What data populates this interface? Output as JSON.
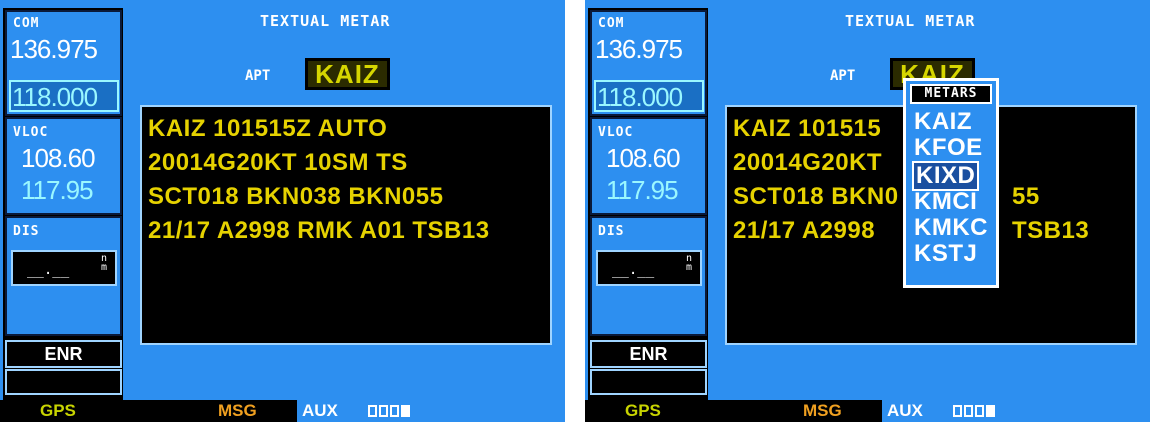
{
  "page_title": "TEXTUAL METAR",
  "left": {
    "com_label": "COM",
    "com_active": "136.975",
    "com_standby": "118.000",
    "vloc_label": "VLOC",
    "vloc_active": "108.60",
    "vloc_standby": "117.95",
    "dis_label": "DIS",
    "dis_value": "__.__",
    "dis_unit_top": "n",
    "dis_unit_bottom": "m",
    "mode": "ENR"
  },
  "apt_label": "APT",
  "apt_value": "KAIZ",
  "metar_lines": [
    "KAIZ 101515Z AUTO",
    "20014G20KT 10SM TS",
    "SCT018 BKN038 BKN055",
    "21/17 A2998 RMK A01 TSB13"
  ],
  "metar_lines_obscured": [
    "KAIZ 101515",
    "20014G20KT",
    "SCT018 BKN0",
    "21/17 A2998",
    "55",
    "TSB13"
  ],
  "popup": {
    "header": "METARS",
    "items": [
      "KAIZ",
      "KFOE",
      "KIXD",
      "KMCI",
      "KMKC",
      "KSTJ"
    ],
    "selected": "KIXD"
  },
  "status_bar": {
    "gps": "GPS",
    "msg": "MSG",
    "aux": "AUX",
    "page_indicator": [
      false,
      false,
      false,
      true
    ]
  },
  "colors": {
    "background": "#2d8ff0",
    "metar_text": "#e6d200",
    "gps_text": "#c8d400",
    "msg_text": "#f0a020"
  }
}
